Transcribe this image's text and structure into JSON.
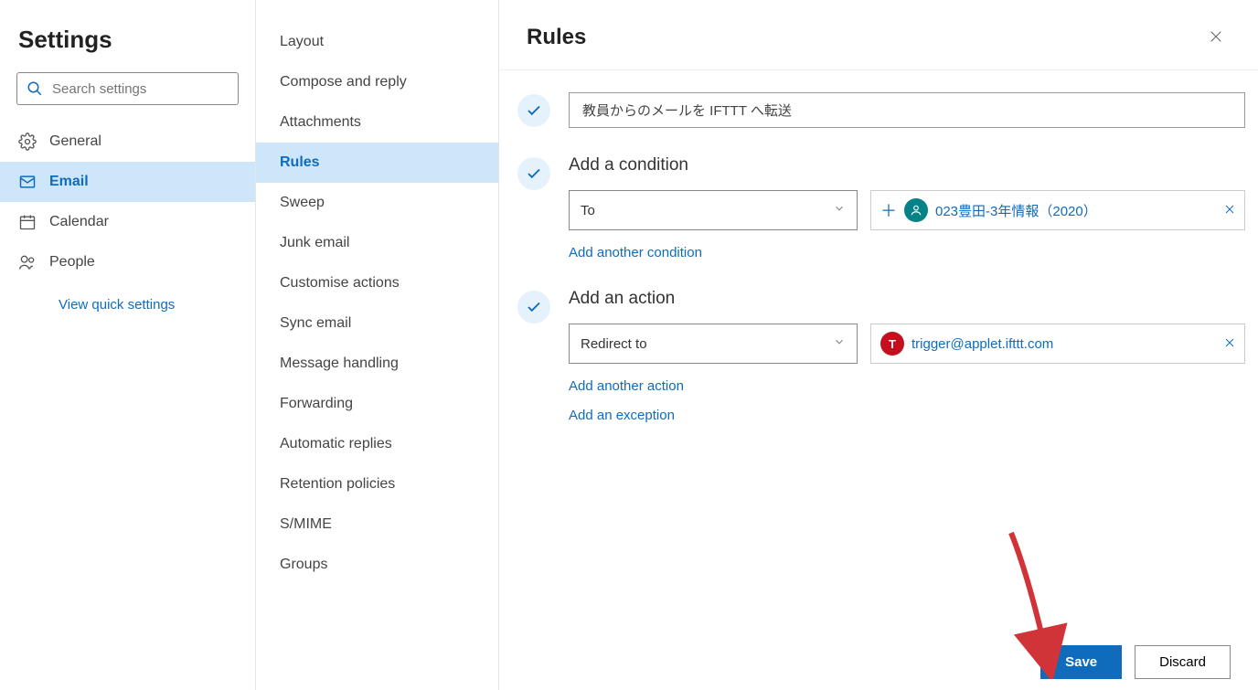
{
  "sidebar": {
    "title": "Settings",
    "search_placeholder": "Search settings",
    "nav": [
      {
        "label": "General"
      },
      {
        "label": "Email"
      },
      {
        "label": "Calendar"
      },
      {
        "label": "People"
      }
    ],
    "quick_link": "View quick settings"
  },
  "submenu": {
    "items": [
      "Layout",
      "Compose and reply",
      "Attachments",
      "Rules",
      "Sweep",
      "Junk email",
      "Customise actions",
      "Sync email",
      "Message handling",
      "Forwarding",
      "Automatic replies",
      "Retention policies",
      "S/MIME",
      "Groups"
    ],
    "active_index": 3
  },
  "main": {
    "title": "Rules",
    "rule_name": "教員からのメールを IFTTT へ転送",
    "condition": {
      "heading": "Add a condition",
      "selected": "To",
      "chip_label": "023豊田-3年情報（2020）",
      "add_another": "Add another condition"
    },
    "action": {
      "heading": "Add an action",
      "selected": "Redirect to",
      "chip_initial": "T",
      "chip_label": "trigger@applet.ifttt.com",
      "add_another": "Add another action",
      "add_exception": "Add an exception"
    },
    "buttons": {
      "save": "Save",
      "discard": "Discard"
    }
  }
}
